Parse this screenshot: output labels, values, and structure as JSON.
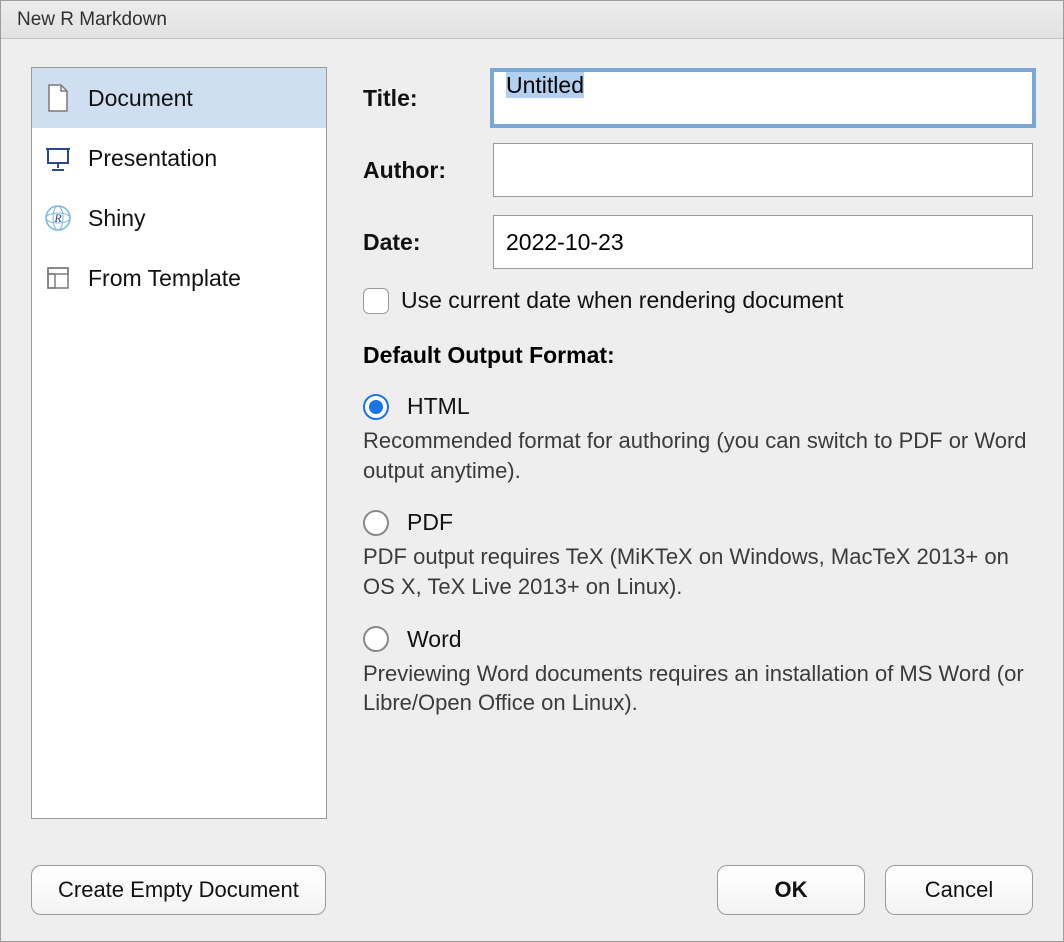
{
  "window_title": "New R Markdown",
  "sidebar": {
    "items": [
      {
        "label": "Document",
        "icon": "document-icon",
        "selected": true
      },
      {
        "label": "Presentation",
        "icon": "presentation-icon",
        "selected": false
      },
      {
        "label": "Shiny",
        "icon": "shiny-icon",
        "selected": false
      },
      {
        "label": "From Template",
        "icon": "template-icon",
        "selected": false
      }
    ]
  },
  "form": {
    "title_label": "Title:",
    "title_value": "Untitled",
    "author_label": "Author:",
    "author_value": "",
    "date_label": "Date:",
    "date_value": "2022-10-23",
    "use_current_date_label": "Use current date when rendering document",
    "use_current_date_checked": false
  },
  "output_section_title": "Default Output Format:",
  "output_formats": [
    {
      "label": "HTML",
      "checked": true,
      "description": "Recommended format for authoring (you can switch to PDF or Word output anytime)."
    },
    {
      "label": "PDF",
      "checked": false,
      "description": "PDF output requires TeX (MiKTeX on Windows, MacTeX 2013+ on OS X, TeX Live 2013+ on Linux)."
    },
    {
      "label": "Word",
      "checked": false,
      "description": "Previewing Word documents requires an installation of MS Word (or Libre/Open Office on Linux)."
    }
  ],
  "buttons": {
    "create_empty": "Create Empty Document",
    "ok": "OK",
    "cancel": "Cancel"
  }
}
